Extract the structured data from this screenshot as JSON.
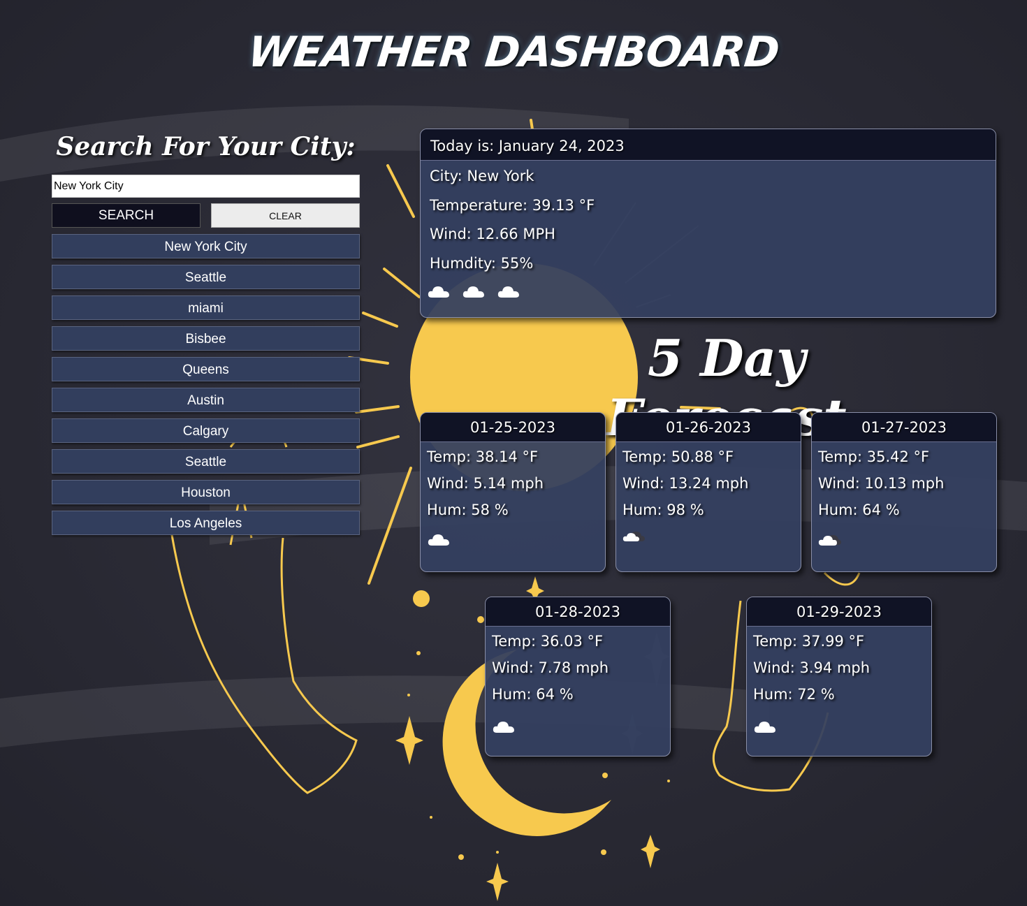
{
  "header": {
    "title": "WEATHER DASHBOARD"
  },
  "search": {
    "heading": "Search For Your City:",
    "input_value": "New York City",
    "search_label": "SEARCH",
    "clear_label": "CLEAR"
  },
  "history": [
    "New York City",
    "Seattle",
    "miami",
    "Bisbee",
    "Queens",
    "Austin",
    "Calgary",
    "Seattle",
    "Houston",
    "Los Angeles"
  ],
  "today": {
    "header": "Today is: January 24, 2023",
    "city": "City: New York",
    "temperature": "Temperature: 39.13 °F",
    "wind": "Wind: 12.66 MPH",
    "humidity": "Humdity: 55%",
    "icons": [
      "cloud-icon",
      "cloud-icon",
      "cloud-icon"
    ]
  },
  "forecast": {
    "title": "5 Day Forecast",
    "days": [
      {
        "date": "01-25-2023",
        "temp": "Temp: 38.14 °F",
        "wind": "Wind: 5.14 mph",
        "hum": "Hum: 58 %",
        "icon": "cloud-icon"
      },
      {
        "date": "01-26-2023",
        "temp": "Temp: 50.88 °F",
        "wind": "Wind: 13.24 mph",
        "hum": "Hum: 98 %",
        "icon": "dark-cloud-icon"
      },
      {
        "date": "01-27-2023",
        "temp": "Temp: 35.42 °F",
        "wind": "Wind: 10.13 mph",
        "hum": "Hum: 64 %",
        "icon": "dark-cloud-icon"
      },
      {
        "date": "01-28-2023",
        "temp": "Temp: 36.03 °F",
        "wind": "Wind: 7.78 mph",
        "hum": "Hum: 64 %",
        "icon": "cloud-icon"
      },
      {
        "date": "01-29-2023",
        "temp": "Temp: 37.99 °F",
        "wind": "Wind: 3.94 mph",
        "hum": "Hum: 72 %",
        "icon": "cloud-icon"
      }
    ]
  },
  "colors": {
    "background": "#2b2b36",
    "card": "#344060",
    "card_header": "#101325",
    "accent_yellow": "#f7c94e"
  }
}
